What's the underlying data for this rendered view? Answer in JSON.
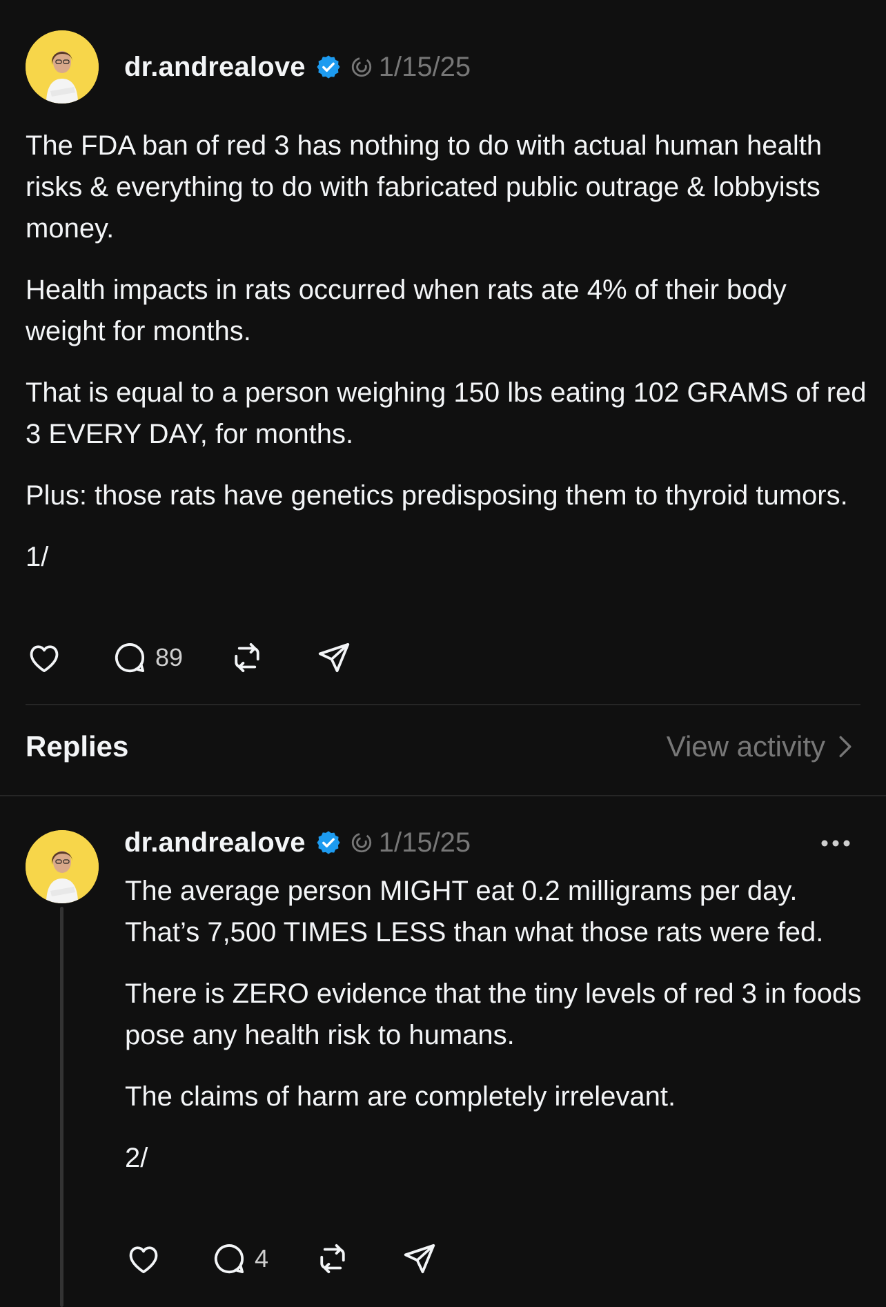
{
  "post": {
    "username": "dr.andrealove",
    "date": "1/15/25",
    "paragraphs": [
      "The FDA ban of red 3 has nothing to do with actual human health risks & everything to do with fabricated public outrage & lobbyists money.",
      "Health impacts in rats occurred when rats ate 4% of their body weight for months.",
      "That is equal to a person weighing 150 lbs eating 102 GRAMS of red 3 EVERY DAY, for months.",
      "Plus: those rats have genetics predisposing them to thyroid tumors.",
      "1/"
    ],
    "reply_count": "89"
  },
  "replies_header": {
    "title": "Replies",
    "view_activity": "View activity"
  },
  "reply": {
    "username": "dr.andrealove",
    "date": "1/15/25",
    "paragraphs": [
      "The average person MIGHT eat 0.2 milligrams per day. That’s 7,500 TIMES LESS than what those rats were fed.",
      "There is ZERO evidence that the tiny levels of red 3 in foods pose any health risk to humans.",
      "The claims of harm are completely irrelevant.",
      "2/"
    ],
    "reply_count": "4"
  },
  "icons": {
    "verified": "verified-badge-icon",
    "threads": "threads-logo-icon",
    "like": "heart-icon",
    "comment": "comment-bubble-icon",
    "repost": "repost-icon",
    "share": "send-icon",
    "chevron": "chevron-right-icon",
    "more": "more-dots-icon"
  },
  "colors": {
    "background": "#101010",
    "text": "#f3f5f7",
    "muted": "#777777",
    "verified": "#1d9bf0",
    "avatar_bg": "#f7d64a"
  }
}
